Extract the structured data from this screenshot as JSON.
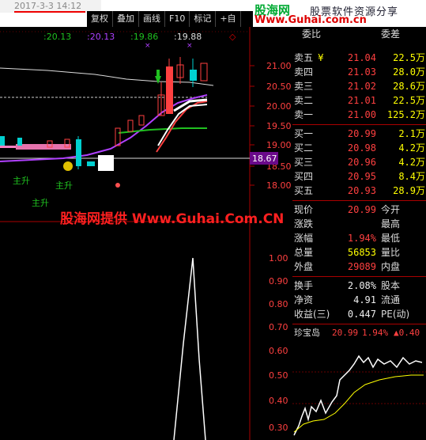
{
  "header": {
    "date": "2017-3-3 14:12",
    "toolbar": [
      "复权",
      "叠加",
      "画线",
      "F10",
      "标记",
      "+自"
    ]
  },
  "brand": {
    "name": "股海网",
    "tagline": "股票软件资源分享",
    "url": "Www.Guhai.com.cn"
  },
  "chart": {
    "ma_labels": [
      ":20.13",
      ":20.13",
      ":19.86",
      ":19.88"
    ],
    "price_axis": [
      "21.00",
      "20.50",
      "20.00",
      "19.50",
      "19.00",
      "18.50",
      "18.00"
    ],
    "current_price": "18.67",
    "signals": [
      "主升",
      "主升",
      "主升"
    ],
    "indicator_axis": [
      "1.00",
      "0.90",
      "0.80",
      "0.70",
      "0.60",
      "0.50",
      "0.40",
      "0.30"
    ],
    "watermark": "股海网提供 Www.Guhai.Com.CN",
    "colors": {
      "up": "#ff4040",
      "down": "#00d0d0",
      "ma_white": "#dddddd",
      "ma_purple": "#b040ff",
      "ma_green": "#20c020"
    }
  },
  "quote": {
    "headers": [
      "委比",
      "委差"
    ],
    "asks": [
      {
        "label": "卖五",
        "flag": "¥",
        "price": "21.04",
        "vol": "22.5万"
      },
      {
        "label": "卖四",
        "price": "21.03",
        "vol": "28.0万"
      },
      {
        "label": "卖三",
        "price": "21.02",
        "vol": "28.6万"
      },
      {
        "label": "卖二",
        "price": "21.01",
        "vol": "22.5万"
      },
      {
        "label": "卖一",
        "price": "21.00",
        "vol": "125.2万"
      }
    ],
    "bids": [
      {
        "label": "买一",
        "price": "20.99",
        "vol": "2.1万"
      },
      {
        "label": "买二",
        "price": "20.98",
        "vol": "4.2万"
      },
      {
        "label": "买三",
        "price": "20.96",
        "vol": "4.2万"
      },
      {
        "label": "买四",
        "price": "20.95",
        "vol": "8.4万"
      },
      {
        "label": "买五",
        "price": "20.93",
        "vol": "28.9万"
      }
    ],
    "stats": [
      {
        "l1": "现价",
        "v1": "20.99",
        "l2": "今开"
      },
      {
        "l1": "涨跌",
        "v1": "",
        "l2": "最高"
      },
      {
        "l1": "涨幅",
        "v1": "1.94%",
        "l2": "最低"
      },
      {
        "l1": "总量",
        "v1": "56853",
        "l2": "量比"
      },
      {
        "l1": "外盘",
        "v1": "29089",
        "l2": "内盘"
      }
    ],
    "stats2": [
      {
        "l1": "换手",
        "v1": "2.08%",
        "l2": "股本"
      },
      {
        "l1": "净资",
        "v1": "4.91",
        "l2": "流通"
      },
      {
        "l1": "收益(三)",
        "v1": "0.447",
        "l2": "PE(动)"
      }
    ],
    "mini": {
      "name": "珍宝岛",
      "price": "20.99",
      "pct": "1.94%",
      "change": "▲0.40"
    }
  }
}
